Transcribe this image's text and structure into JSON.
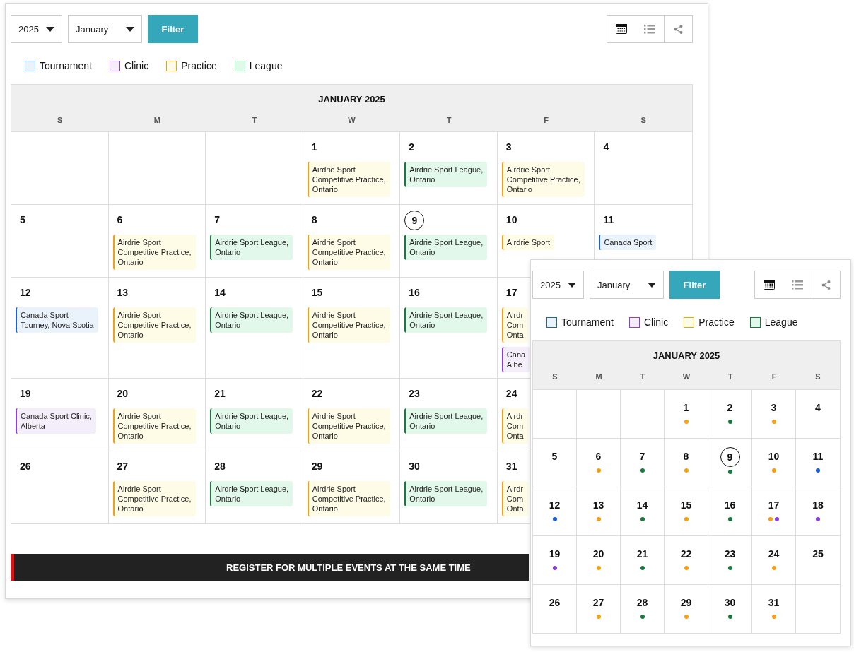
{
  "desktop": {
    "year": "2025",
    "month": "January",
    "filter": "Filter",
    "views": [
      {
        "kind": "calendar",
        "selected": true
      },
      {
        "kind": "list",
        "selected": false
      }
    ],
    "legend": [
      {
        "kind": "tournament",
        "label": "Tournament",
        "color": "#1a5fd6"
      },
      {
        "kind": "clinic",
        "label": "Clinic",
        "color": "#8a3fd6"
      },
      {
        "kind": "practice",
        "label": "Practice",
        "color": "#f5a011"
      },
      {
        "kind": "league",
        "label": "League",
        "color": "#177a3c"
      }
    ],
    "calendar_title": "JANUARY 2025",
    "weekdays": [
      "S",
      "M",
      "T",
      "W",
      "T",
      "F",
      "S"
    ],
    "weeks": [
      {
        "kind": "first",
        "days": [
          {
            "day": "1",
            "today": false,
            "events": [
              {
                "kind": "practice",
                "lines": [
                  "Airdrie Sport",
                  "Competitive Practice,",
                  "Ontario"
                ]
              }
            ]
          },
          {
            "day": "2",
            "today": false,
            "events": [
              {
                "kind": "league",
                "lines": [
                  "Airdrie Sport League,",
                  "Ontario"
                ]
              }
            ]
          },
          {
            "day": "3",
            "today": false,
            "events": [
              {
                "kind": "practice",
                "lines": [
                  "Airdrie Sport",
                  "Competitive Practice,",
                  "Ontario"
                ]
              }
            ]
          },
          {
            "day": "4",
            "today": false
          }
        ]
      },
      {
        "kind": "rest",
        "days": [
          {
            "day": "5",
            "today": false
          },
          {
            "day": "6",
            "today": false,
            "events": [
              {
                "kind": "practice",
                "lines": [
                  "Airdrie Sport",
                  "Competitive Practice,",
                  "Ontario"
                ]
              }
            ]
          },
          {
            "day": "7",
            "today": false,
            "events": [
              {
                "kind": "league",
                "lines": [
                  "Airdrie Sport League,",
                  "Ontario"
                ]
              }
            ]
          },
          {
            "day": "8",
            "today": false,
            "events": [
              {
                "kind": "practice",
                "lines": [
                  "Airdrie Sport",
                  "Competitive Practice,",
                  "Ontario"
                ]
              }
            ]
          },
          {
            "day": "9",
            "today": true,
            "events": [
              {
                "kind": "league",
                "lines": [
                  "Airdrie Sport League,",
                  "Ontario"
                ]
              }
            ]
          },
          {
            "day": "10",
            "today": false,
            "events": [
              {
                "kind": "practice",
                "lines": [
                  "Airdrie Sport"
                ]
              }
            ]
          },
          {
            "day": "11",
            "today": false,
            "events": [
              {
                "kind": "tournament",
                "lines": [
                  "Canada Sport"
                ]
              }
            ]
          }
        ]
      },
      {
        "kind": "rest",
        "days": [
          {
            "day": "12",
            "today": false,
            "events": [
              {
                "kind": "tournament",
                "lines": [
                  "Canada Sport",
                  "Tourney, Nova Scotia"
                ]
              }
            ]
          },
          {
            "day": "13",
            "today": false,
            "events": [
              {
                "kind": "practice",
                "lines": [
                  "Airdrie Sport",
                  "Competitive Practice,",
                  "Ontario"
                ]
              }
            ]
          },
          {
            "day": "14",
            "today": false,
            "events": [
              {
                "kind": "league",
                "lines": [
                  "Airdrie Sport League,",
                  "Ontario"
                ]
              }
            ]
          },
          {
            "day": "15",
            "today": false,
            "events": [
              {
                "kind": "practice",
                "lines": [
                  "Airdrie Sport",
                  "Competitive Practice,",
                  "Ontario"
                ]
              }
            ]
          },
          {
            "day": "16",
            "today": false,
            "events": [
              {
                "kind": "league",
                "lines": [
                  "Airdrie Sport League,",
                  "Ontario"
                ]
              }
            ]
          },
          {
            "day": "17",
            "today": false,
            "events": [
              {
                "kind": "practice",
                "lines": [
                  "Airdr",
                  "Com",
                  "Onta"
                ]
              },
              {
                "kind": "clinic",
                "lines": [
                  "Cana",
                  "Albe"
                ]
              }
            ]
          }
        ]
      },
      {
        "kind": "rest",
        "days": [
          {
            "day": "19",
            "today": false,
            "events": [
              {
                "kind": "clinic",
                "lines": [
                  "Canada Sport Clinic,",
                  "Alberta"
                ]
              }
            ]
          },
          {
            "day": "20",
            "today": false,
            "events": [
              {
                "kind": "practice",
                "lines": [
                  "Airdrie Sport",
                  "Competitive Practice,",
                  "Ontario"
                ]
              }
            ]
          },
          {
            "day": "21",
            "today": false,
            "events": [
              {
                "kind": "league",
                "lines": [
                  "Airdrie Sport League,",
                  "Ontario"
                ]
              }
            ]
          },
          {
            "day": "22",
            "today": false,
            "events": [
              {
                "kind": "practice",
                "lines": [
                  "Airdrie Sport",
                  "Competitive Practice,",
                  "Ontario"
                ]
              }
            ]
          },
          {
            "day": "23",
            "today": false,
            "events": [
              {
                "kind": "league",
                "lines": [
                  "Airdrie Sport League,",
                  "Ontario"
                ]
              }
            ]
          },
          {
            "day": "24",
            "today": false,
            "events": [
              {
                "kind": "practice",
                "lines": [
                  "Airdr",
                  "Com",
                  "Onta"
                ]
              }
            ]
          }
        ]
      },
      {
        "kind": "rest",
        "days": [
          {
            "day": "26",
            "today": false
          },
          {
            "day": "27",
            "today": false,
            "events": [
              {
                "kind": "practice",
                "lines": [
                  "Airdrie Sport",
                  "Competitive Practice,",
                  "Ontario"
                ]
              }
            ]
          },
          {
            "day": "28",
            "today": false,
            "events": [
              {
                "kind": "league",
                "lines": [
                  "Airdrie Sport League,",
                  "Ontario"
                ]
              }
            ]
          },
          {
            "day": "29",
            "today": false,
            "events": [
              {
                "kind": "practice",
                "lines": [
                  "Airdrie Sport",
                  "Competitive Practice,",
                  "Ontario"
                ]
              }
            ]
          },
          {
            "day": "30",
            "today": false,
            "events": [
              {
                "kind": "league",
                "lines": [
                  "Airdrie Sport League,",
                  "Ontario"
                ]
              }
            ]
          },
          {
            "day": "31",
            "today": false,
            "events": [
              {
                "kind": "practice",
                "lines": [
                  "Airdr",
                  "Com",
                  "Onta"
                ]
              }
            ]
          }
        ]
      }
    ],
    "banner": "REGISTER FOR MULTIPLE EVENTS AT THE SAME TIME"
  },
  "mobile": {
    "year": "2025",
    "month": "January",
    "filter": "Filter",
    "views": [
      {
        "kind": "calendar",
        "selected": true
      },
      {
        "kind": "list",
        "selected": false
      }
    ],
    "legend": [
      {
        "kind": "tournament",
        "label": "Tournament",
        "color": "#1a5fd6"
      },
      {
        "kind": "clinic",
        "label": "Clinic",
        "color": "#8a3fd6"
      },
      {
        "kind": "practice",
        "label": "Practice",
        "color": "#f5a011"
      },
      {
        "kind": "league",
        "label": "League",
        "color": "#177a3c"
      }
    ],
    "calendar_title": "JANUARY 2025",
    "weekdays": [
      "S",
      "M",
      "T",
      "W",
      "T",
      "F",
      "S"
    ],
    "weeks": [
      {
        "kind": "first",
        "days": [
          {
            "day": "1",
            "today": false,
            "dots": [
              {
                "color": "#f5a011"
              }
            ]
          },
          {
            "day": "2",
            "today": false,
            "dots": [
              {
                "color": "#177a3c"
              }
            ]
          },
          {
            "day": "3",
            "today": false,
            "dots": [
              {
                "color": "#f5a011"
              }
            ]
          },
          {
            "day": "4",
            "today": false
          }
        ]
      },
      {
        "kind": "rest",
        "days": [
          {
            "day": "5",
            "today": false
          },
          {
            "day": "6",
            "today": false,
            "dots": [
              {
                "color": "#f5a011"
              }
            ]
          },
          {
            "day": "7",
            "today": false,
            "dots": [
              {
                "color": "#177a3c"
              }
            ]
          },
          {
            "day": "8",
            "today": false,
            "dots": [
              {
                "color": "#f5a011"
              }
            ]
          },
          {
            "day": "9",
            "today": true,
            "dots": [
              {
                "color": "#177a3c"
              }
            ]
          },
          {
            "day": "10",
            "today": false,
            "dots": [
              {
                "color": "#f5a011"
              }
            ]
          },
          {
            "day": "11",
            "today": false,
            "dots": [
              {
                "color": "#1a5fd6"
              }
            ]
          }
        ]
      },
      {
        "kind": "rest",
        "days": [
          {
            "day": "12",
            "today": false,
            "dots": [
              {
                "color": "#1a5fd6"
              }
            ]
          },
          {
            "day": "13",
            "today": false,
            "dots": [
              {
                "color": "#f5a011"
              }
            ]
          },
          {
            "day": "14",
            "today": false,
            "dots": [
              {
                "color": "#177a3c"
              }
            ]
          },
          {
            "day": "15",
            "today": false,
            "dots": [
              {
                "color": "#f5a011"
              }
            ]
          },
          {
            "day": "16",
            "today": false,
            "dots": [
              {
                "color": "#177a3c"
              }
            ]
          },
          {
            "day": "17",
            "today": false,
            "dots": [
              {
                "color": "#f5a011"
              },
              {
                "color": "#8a3fd6"
              }
            ]
          },
          {
            "day": "18",
            "today": false,
            "dots": [
              {
                "color": "#8a3fd6"
              }
            ]
          }
        ]
      },
      {
        "kind": "rest",
        "days": [
          {
            "day": "19",
            "today": false,
            "dots": [
              {
                "color": "#8a3fd6"
              }
            ]
          },
          {
            "day": "20",
            "today": false,
            "dots": [
              {
                "color": "#f5a011"
              }
            ]
          },
          {
            "day": "21",
            "today": false,
            "dots": [
              {
                "color": "#177a3c"
              }
            ]
          },
          {
            "day": "22",
            "today": false,
            "dots": [
              {
                "color": "#f5a011"
              }
            ]
          },
          {
            "day": "23",
            "today": false,
            "dots": [
              {
                "color": "#177a3c"
              }
            ]
          },
          {
            "day": "24",
            "today": false,
            "dots": [
              {
                "color": "#f5a011"
              }
            ]
          },
          {
            "day": "25",
            "today": false
          }
        ]
      },
      {
        "kind": "rest",
        "days": [
          {
            "day": "26",
            "today": false
          },
          {
            "day": "27",
            "today": false,
            "dots": [
              {
                "color": "#f5a011"
              }
            ]
          },
          {
            "day": "28",
            "today": false,
            "dots": [
              {
                "color": "#177a3c"
              }
            ]
          },
          {
            "day": "29",
            "today": false,
            "dots": [
              {
                "color": "#f5a011"
              }
            ]
          },
          {
            "day": "30",
            "today": false,
            "dots": [
              {
                "color": "#177a3c"
              }
            ]
          },
          {
            "day": "31",
            "today": false,
            "dots": [
              {
                "color": "#f5a011"
              }
            ]
          }
        ]
      }
    ]
  }
}
